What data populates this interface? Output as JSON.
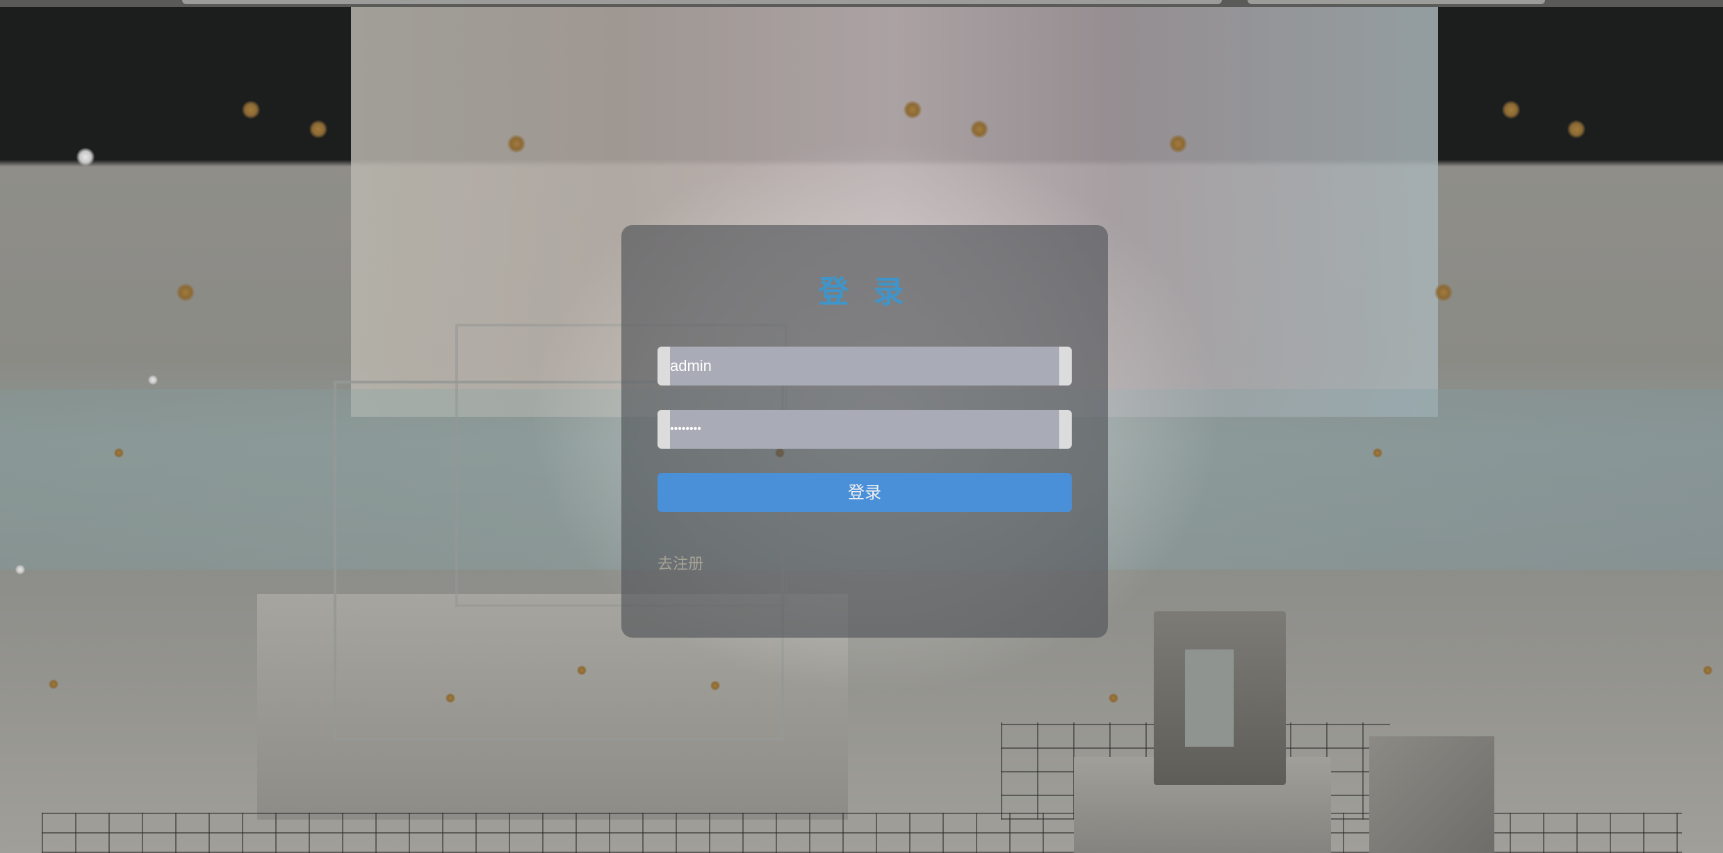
{
  "login": {
    "title": "登 录",
    "username_value": "admin",
    "password_value": "••••••••",
    "submit_label": "登录",
    "register_link": "去注册"
  },
  "colors": {
    "title": "#3f95c9",
    "button": "#4a90d9",
    "card": "#4e5055",
    "link": "#a7a297"
  }
}
